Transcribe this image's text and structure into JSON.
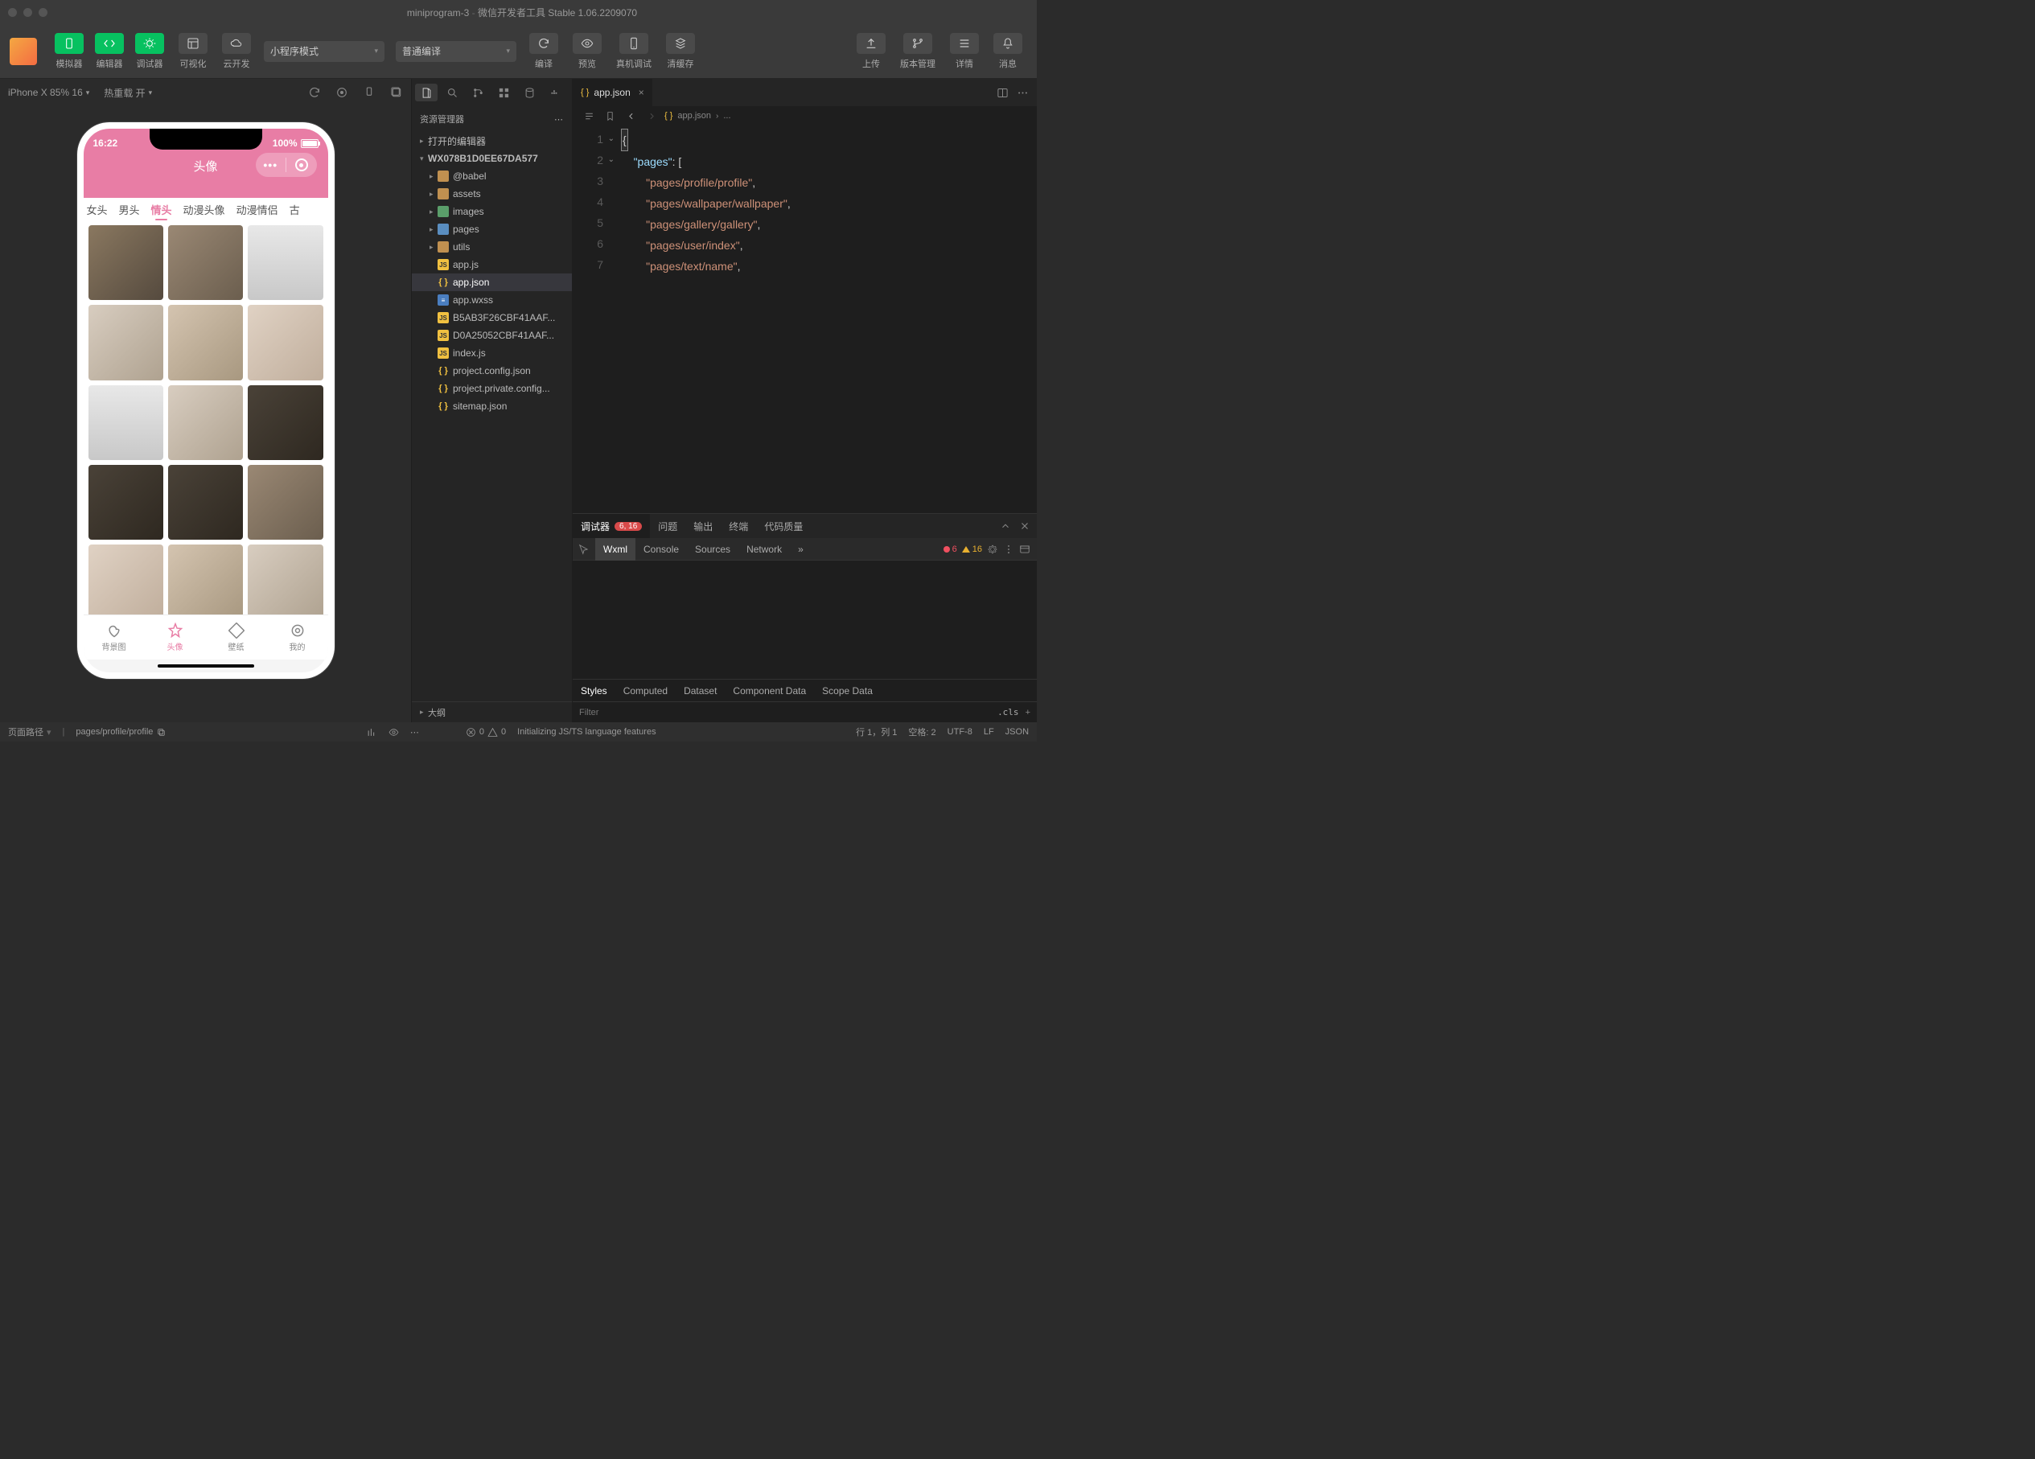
{
  "titlebar": {
    "project": "miniprogram-3",
    "tool": "微信开发者工具 Stable 1.06.2209070"
  },
  "toolbar": {
    "simulator": "模拟器",
    "editor": "编辑器",
    "debugger": "调试器",
    "visualize": "可视化",
    "cloud": "云开发",
    "mode": "小程序模式",
    "compile": "普通编译",
    "build": "编译",
    "preview": "预览",
    "realdev": "真机调试",
    "clearcache": "清缓存",
    "upload": "上传",
    "version": "版本管理",
    "details": "详情",
    "notify": "消息"
  },
  "sim": {
    "device": "iPhone X 85% 16",
    "hotreload": "热重载 开"
  },
  "app": {
    "time": "16:22",
    "battery": "100%",
    "title": "头像",
    "tabs": [
      "女头",
      "男头",
      "情头",
      "动漫头像",
      "动漫情侣",
      "古"
    ],
    "tabbar": {
      "bg": "背景图",
      "avatar": "头像",
      "wall": "壁纸",
      "mine": "我的"
    }
  },
  "explorer": {
    "title": "资源管理器",
    "open_editors": "打开的编辑器",
    "root": "WX078B1D0EE67DA577",
    "folders": [
      "@babel",
      "assets",
      "images",
      "pages",
      "utils"
    ],
    "files": [
      "app.js",
      "app.json",
      "app.wxss",
      "B5AB3F26CBF41AAF...",
      "D0A25052CBF41AAF...",
      "index.js",
      "project.config.json",
      "project.private.config...",
      "sitemap.json"
    ],
    "outline": "大纲"
  },
  "editor": {
    "tab": "app.json",
    "crumb": "app.json",
    "crumb_more": "...",
    "code": {
      "k_pages": "\"pages\"",
      "l3": "\"pages/profile/profile\"",
      "l4": "\"pages/wallpaper/wallpaper\"",
      "l5": "\"pages/gallery/gallery\"",
      "l6": "\"pages/user/index\"",
      "l7": "\"pages/text/name\""
    }
  },
  "debugger": {
    "tab_dbg": "调试器",
    "badge": "6, 16",
    "tab_prob": "问题",
    "tab_out": "输出",
    "tab_term": "终端",
    "tab_quality": "代码质量",
    "wxml": "Wxml",
    "console": "Console",
    "sources": "Sources",
    "network": "Network",
    "err": "6",
    "warn": "16",
    "styles": "Styles",
    "computed": "Computed",
    "dataset": "Dataset",
    "compdata": "Component Data",
    "scopedata": "Scope Data",
    "filter_ph": "Filter",
    "cls": ".cls"
  },
  "status": {
    "pagepath_lbl": "页面路径",
    "pagepath": "pages/profile/profile",
    "err": "0",
    "warn": "0",
    "init": "Initializing JS/TS language features",
    "pos": "行 1，列 1",
    "spaces": "空格: 2",
    "enc": "UTF-8",
    "eol": "LF",
    "lang": "JSON"
  }
}
